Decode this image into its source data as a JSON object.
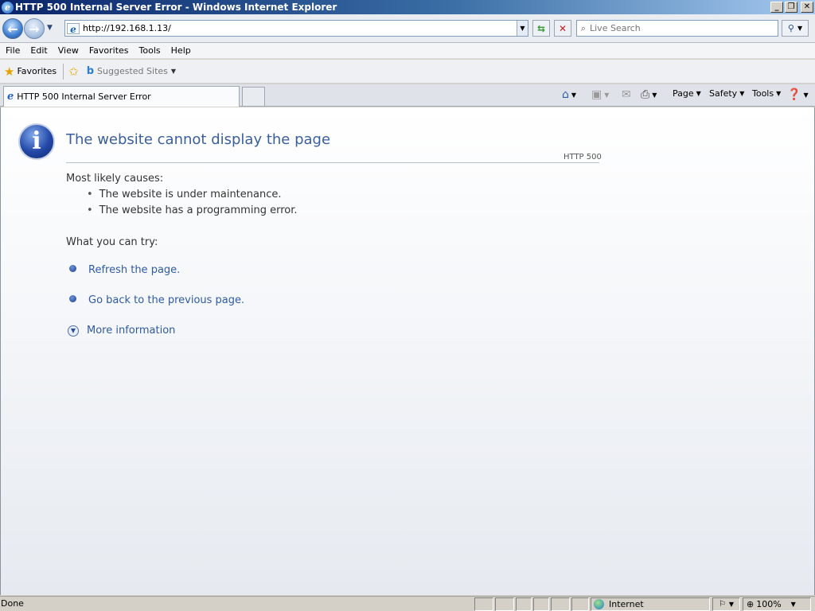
{
  "window": {
    "title": "HTTP 500 Internal Server Error - Windows Internet Explorer",
    "minimize": "_",
    "maximize": "❐",
    "close": "✕"
  },
  "address": {
    "url": "http://192.168.1.13/",
    "search_placeholder": "Live Search"
  },
  "menu": [
    "File",
    "Edit",
    "View",
    "Favorites",
    "Tools",
    "Help"
  ],
  "favorites_bar": {
    "favorites_label": "Favorites",
    "suggested_sites": "Suggested Sites"
  },
  "tab": {
    "title": "HTTP 500 Internal Server Error"
  },
  "command_bar": {
    "page": "Page",
    "safety": "Safety",
    "tools": "Tools"
  },
  "content": {
    "headline": "The website cannot display the page",
    "error_code": "HTTP 500",
    "causes_heading": "Most likely causes:",
    "causes": [
      "The website is under maintenance.",
      "The website has a programming error."
    ],
    "try_heading": "What you can try:",
    "actions": [
      "Refresh the page.",
      "Go back to the previous page."
    ],
    "more_info": "More information"
  },
  "status": {
    "text": "Done",
    "zone": "Internet",
    "zoom": "100%"
  },
  "colors": {
    "link": "#2f5aa3",
    "headline": "#3a5f9a",
    "title_bar": "#0a246a"
  },
  "icons": [
    "ie-icon",
    "back-arrow-icon",
    "forward-arrow-icon",
    "refresh-icon",
    "stop-icon",
    "search-icon",
    "star-icon",
    "info-icon",
    "home-icon",
    "feed-icon",
    "print-icon",
    "help-icon",
    "globe-icon",
    "zoom-icon"
  ]
}
